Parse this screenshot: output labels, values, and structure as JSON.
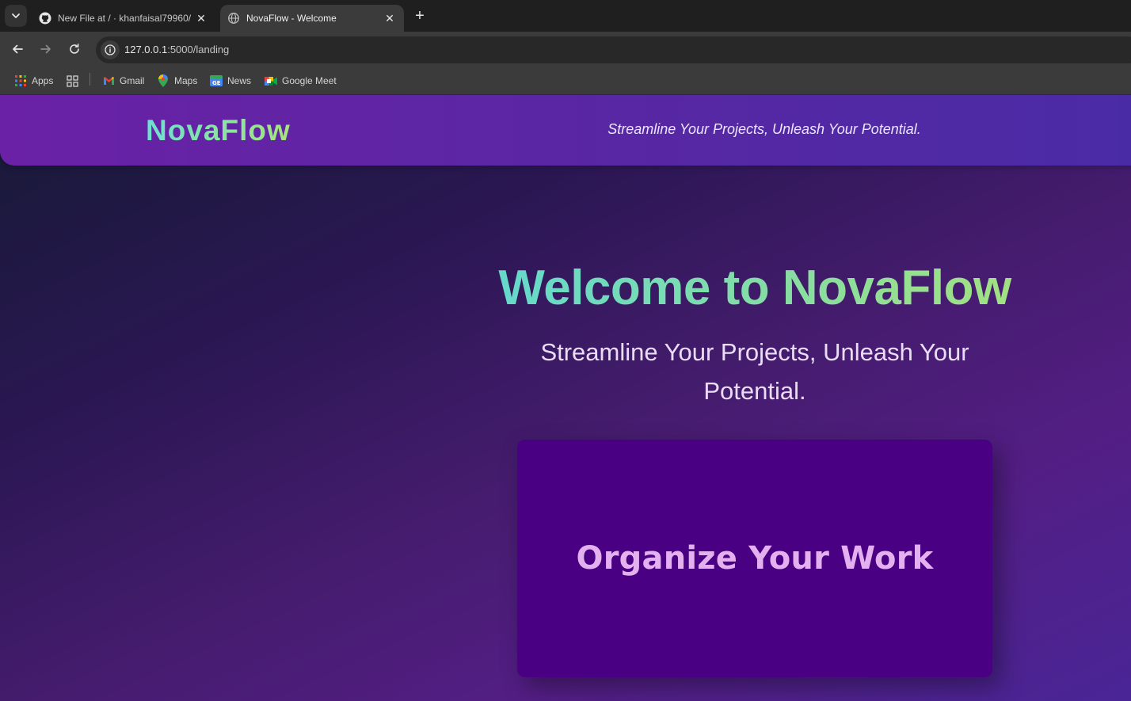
{
  "browser": {
    "tabs": [
      {
        "title": "New File at / · khanfaisal79960/",
        "icon": "github-icon",
        "active": false
      },
      {
        "title": "NovaFlow - Welcome",
        "icon": "globe-icon",
        "active": true
      }
    ],
    "new_tab_label": "+",
    "close_label": "✕",
    "address": {
      "host": "127.0.0.1",
      "path": ":5000/landing"
    },
    "bookmarks": [
      {
        "label": "Apps",
        "icon": "apps-grid-icon"
      },
      {
        "label": "",
        "icon": "tab-groups-icon"
      },
      {
        "label": "Gmail",
        "icon": "gmail-icon"
      },
      {
        "label": "Maps",
        "icon": "maps-icon"
      },
      {
        "label": "News",
        "icon": "news-icon"
      },
      {
        "label": "Google Meet",
        "icon": "google-meet-icon"
      }
    ]
  },
  "site": {
    "logo": "NovaFlow",
    "tagline": "Streamline Your Projects, Unleash Your Potential.",
    "hero": {
      "title": "Welcome to NovaFlow",
      "subtitle": "Streamline Your Projects, Unleash Your Potential."
    },
    "feature_card": {
      "title": "Organize Your Work"
    }
  },
  "colors": {
    "header_start": "#6a21a6",
    "header_end": "#4a2ba6",
    "logo_gradient_start": "#6ee0d0",
    "logo_gradient_end": "#a6e57c",
    "card_bg": "#4a0082",
    "card_text": "#e4b1f0"
  }
}
